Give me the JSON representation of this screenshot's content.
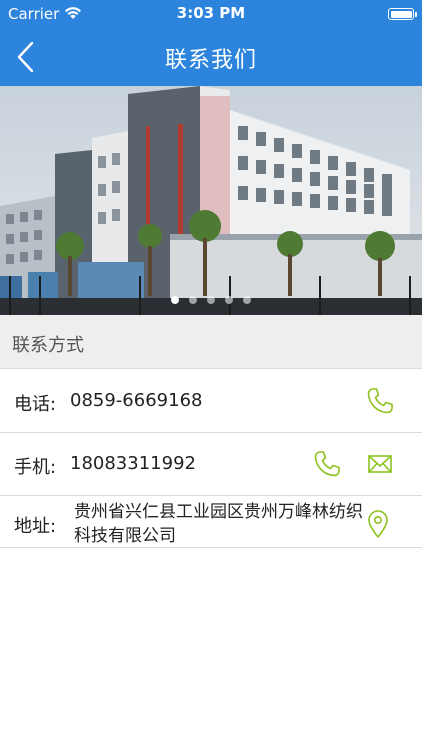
{
  "status_bar": {
    "carrier": "Carrier",
    "time": "3:03 PM"
  },
  "nav": {
    "title": "联系我们",
    "back_icon": "chevron-left-icon"
  },
  "hero": {
    "slide_count": 5,
    "active_index": 0
  },
  "section": {
    "title": "联系方式"
  },
  "contacts": {
    "phone": {
      "label": "电话:",
      "value": "0859-6669168"
    },
    "mobile": {
      "label": "手机:",
      "value": "18083311992"
    },
    "address": {
      "label": "地址:",
      "value": "贵州省兴仁县工业园区贵州万峰林纺织科技有限公司"
    }
  },
  "colors": {
    "brand_blue": "#2c84dd",
    "icon_green": "#8dc21f",
    "section_bg": "#eeeeee"
  }
}
